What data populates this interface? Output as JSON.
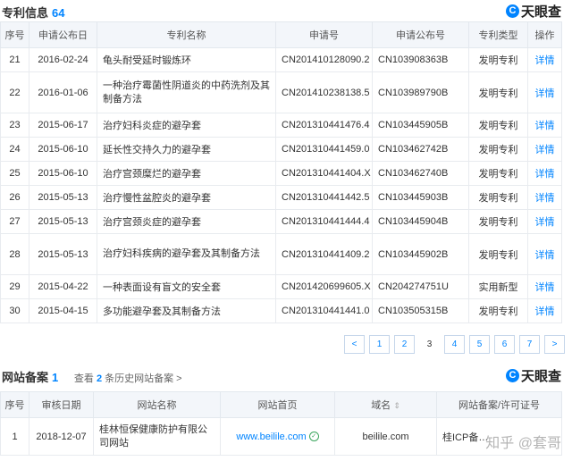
{
  "patents": {
    "title": "专利信息",
    "count": "64",
    "brand": "天眼查",
    "headers": [
      "序号",
      "申请公布日",
      "专利名称",
      "申请号",
      "申请公布号",
      "专利类型",
      "操作"
    ],
    "rows": [
      {
        "no": "21",
        "date": "2016-02-24",
        "name": "龟头耐受延时锻炼环",
        "app_no": "CN201410128090.2",
        "pub_no": "CN103908363B",
        "type": "发明专利",
        "action": "详情"
      },
      {
        "no": "22",
        "date": "2016-01-06",
        "name": "一种治疗霉菌性阴道炎的中药洗剂及其制备方法",
        "app_no": "CN201410238138.5",
        "pub_no": "CN103989790B",
        "type": "发明专利",
        "action": "详情"
      },
      {
        "no": "23",
        "date": "2015-06-17",
        "name": "治疗妇科炎症的避孕套",
        "app_no": "CN201310441476.4",
        "pub_no": "CN103445905B",
        "type": "发明专利",
        "action": "详情"
      },
      {
        "no": "24",
        "date": "2015-06-10",
        "name": "延长性交持久力的避孕套",
        "app_no": "CN201310441459.0",
        "pub_no": "CN103462742B",
        "type": "发明专利",
        "action": "详情"
      },
      {
        "no": "25",
        "date": "2015-06-10",
        "name": "治疗宫颈糜烂的避孕套",
        "app_no": "CN201310441404.X",
        "pub_no": "CN103462740B",
        "type": "发明专利",
        "action": "详情"
      },
      {
        "no": "26",
        "date": "2015-05-13",
        "name": "治疗慢性盆腔炎的避孕套",
        "app_no": "CN201310441442.5",
        "pub_no": "CN103445903B",
        "type": "发明专利",
        "action": "详情"
      },
      {
        "no": "27",
        "date": "2015-05-13",
        "name": "治疗宫颈炎症的避孕套",
        "app_no": "CN201310441444.4",
        "pub_no": "CN103445904B",
        "type": "发明专利",
        "action": "详情"
      },
      {
        "no": "28",
        "date": "2015-05-13",
        "name": "治疗妇科疾病的避孕套及其制备方法",
        "app_no": "CN201310441409.2",
        "pub_no": "CN103445902B",
        "type": "发明专利",
        "action": "详情"
      },
      {
        "no": "29",
        "date": "2015-04-22",
        "name": "一种表面设有盲文的安全套",
        "app_no": "CN201420699605.X",
        "pub_no": "CN204274751U",
        "type": "实用新型",
        "action": "详情"
      },
      {
        "no": "30",
        "date": "2015-04-15",
        "name": "多功能避孕套及其制备方法",
        "app_no": "CN201310441441.0",
        "pub_no": "CN103505315B",
        "type": "发明专利",
        "action": "详情"
      }
    ]
  },
  "pagination": {
    "prev": "<",
    "pages": [
      "1",
      "2",
      "3",
      "4",
      "5",
      "6",
      "7"
    ],
    "current": "3",
    "next": ">"
  },
  "websites": {
    "title": "网站备案",
    "count": "1",
    "history_prefix": "查看",
    "history_count": "2",
    "history_suffix": "条历史网站备案 >",
    "brand": "天眼查",
    "headers": [
      "序号",
      "审核日期",
      "网站名称",
      "网站首页",
      "域名",
      "网站备案/许可证号"
    ],
    "rows": [
      {
        "no": "1",
        "date": "2018-12-07",
        "name": "桂林恒保健康防护有限公司网站",
        "homepage": "www.beilile.com",
        "domain": "beilile.com",
        "license": "桂ICP备…"
      }
    ],
    "icons": {
      "verified": "check-circle-icon",
      "sort": "sort-icon"
    },
    "watermark": "知乎 @套哥"
  },
  "colors": {
    "accent": "#0084ff",
    "header_bg": "#f3f6fa",
    "verified": "#3aa55c"
  }
}
